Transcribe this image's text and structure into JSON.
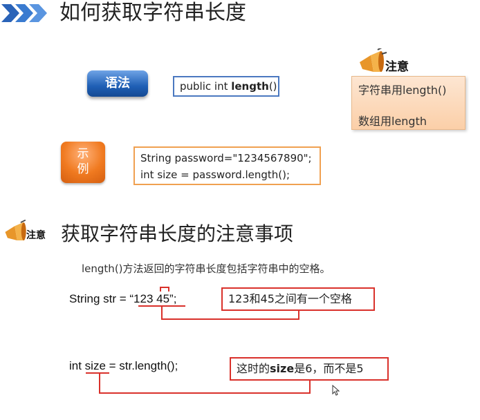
{
  "header": {
    "title": "如何获取字符串长度",
    "chevrons_icon": "triple-chevron-right-icon",
    "accent": "#1f5fb5"
  },
  "syntax": {
    "badge": "语法",
    "code_prefix": "public int ",
    "code_bold": "length",
    "code_suffix": "()"
  },
  "example": {
    "badge_top": "示",
    "badge_bottom": "例",
    "lines": [
      "String password=\"1234567890\";",
      "int size = password.length();"
    ]
  },
  "note_top": {
    "label": "注意",
    "icon": "megaphone-icon",
    "lines": [
      "字符串用length()",
      "数组用length"
    ]
  },
  "section2": {
    "note_label": "注意",
    "heading": "获取字符串长度的注意事项",
    "description": "length()方法返回的字符串长度包括字符串中的空格。"
  },
  "code_examples": [
    {
      "code": "String str = “123 45”;",
      "callout": "123和45之间有一个空格"
    },
    {
      "code": "int size = str.length();",
      "callout_prefix": "这时的",
      "callout_bold": "size",
      "callout_suffix": "是6，而不是5"
    }
  ],
  "colors": {
    "callout_border": "#d9302a",
    "example_border": "#f0a050",
    "syntax_border": "#4a78c0"
  }
}
